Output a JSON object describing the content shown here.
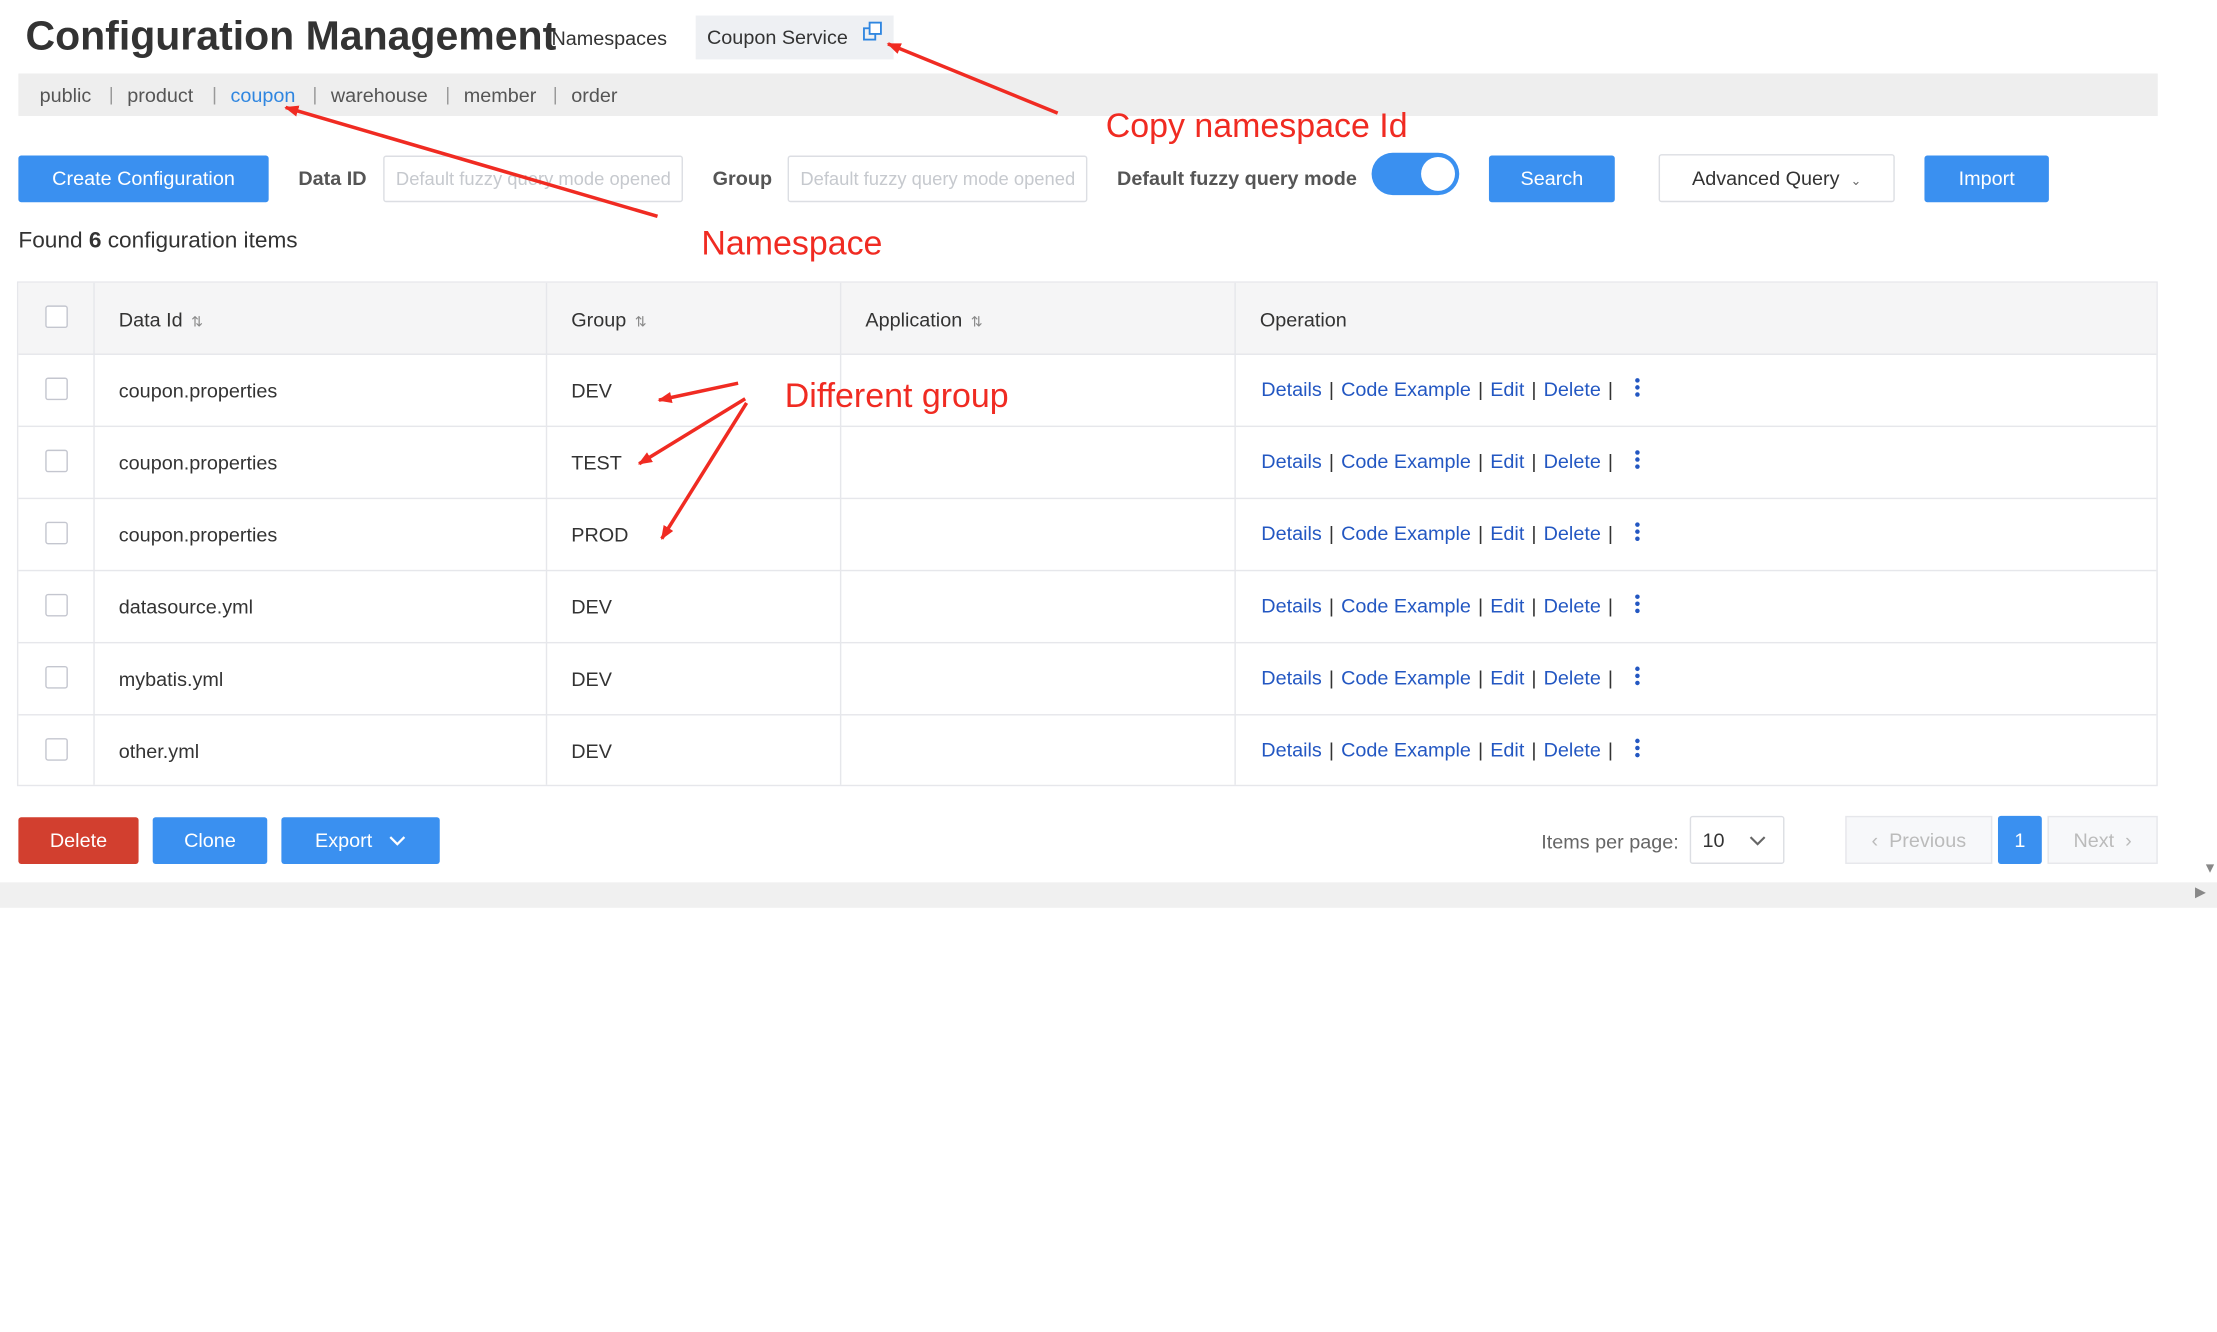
{
  "header": {
    "title": "Configuration Management",
    "namespaces_label": "Namespaces",
    "current_namespace": "Coupon Service"
  },
  "namespace_tabs": [
    "public",
    "product",
    "coupon",
    "warehouse",
    "member",
    "order"
  ],
  "active_namespace": "coupon",
  "toolbar": {
    "create_label": "Create Configuration",
    "data_id_label": "Data ID",
    "data_id_placeholder": "Default fuzzy query mode opened",
    "group_label": "Group",
    "group_placeholder": "Default fuzzy query mode opened",
    "fuzzy_label": "Default fuzzy query mode",
    "fuzzy_enabled": true,
    "search_label": "Search",
    "advanced_label": "Advanced Query",
    "import_label": "Import"
  },
  "found": {
    "prefix": "Found",
    "count": "6",
    "suffix": "configuration items"
  },
  "table": {
    "columns": [
      "Data Id",
      "Group",
      "Application",
      "Operation"
    ],
    "rows": [
      {
        "data_id": "coupon.properties",
        "group": "DEV",
        "application": ""
      },
      {
        "data_id": "coupon.properties",
        "group": "TEST",
        "application": ""
      },
      {
        "data_id": "coupon.properties",
        "group": "PROD",
        "application": ""
      },
      {
        "data_id": "datasource.yml",
        "group": "DEV",
        "application": ""
      },
      {
        "data_id": "mybatis.yml",
        "group": "DEV",
        "application": ""
      },
      {
        "data_id": "other.yml",
        "group": "DEV",
        "application": ""
      }
    ],
    "operations": [
      "Details",
      "Code Example",
      "Edit",
      "Delete"
    ]
  },
  "footer": {
    "delete_label": "Delete",
    "clone_label": "Clone",
    "export_label": "Export",
    "items_per_page_label": "Items per page:",
    "items_per_page": "10",
    "previous_label": "Previous",
    "current_page": "1",
    "next_label": "Next"
  },
  "annotations": {
    "copy_ns": "Copy namespace Id",
    "namespace": "Namespace",
    "different_group": "Different group"
  },
  "colors": {
    "primary": "#3a90f0",
    "danger": "#d23f2f",
    "annotation": "#f02b22",
    "link": "#2357c2"
  }
}
